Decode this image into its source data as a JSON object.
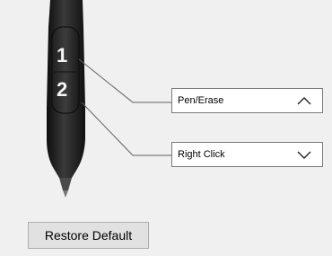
{
  "pen": {
    "button_1_label": "1",
    "button_2_label": "2"
  },
  "dropdowns": [
    {
      "value": "Pen/Erase",
      "chevron": "chevron-up-icon"
    },
    {
      "value": "Right Click",
      "chevron": "chevron-down-icon"
    }
  ],
  "restore_button": {
    "label": "Restore Default"
  },
  "colors": {
    "background": "#f0f0f0",
    "pen_body": "#1c1c1c",
    "connector_line": "#606060"
  }
}
